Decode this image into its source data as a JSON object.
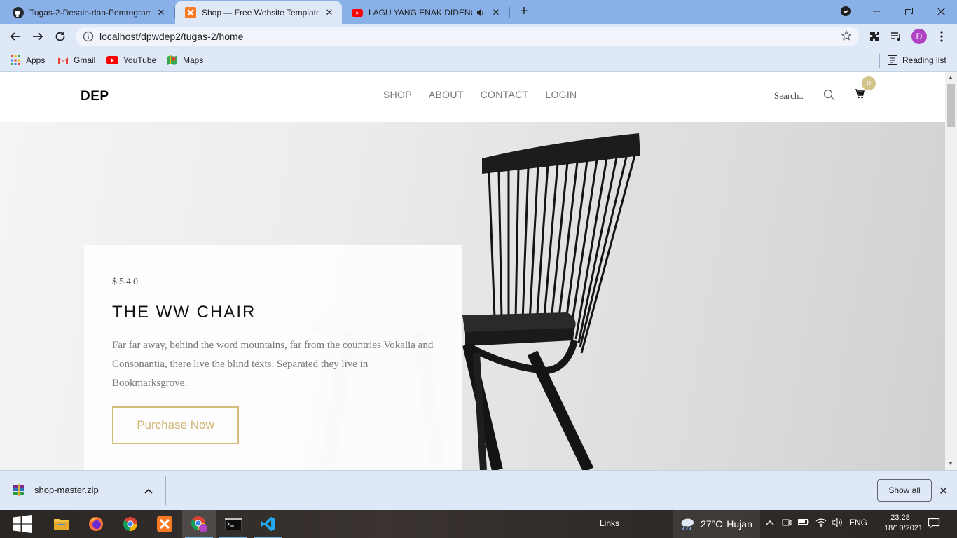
{
  "browser": {
    "tabs": [
      {
        "title": "Tugas-2-Desain-dan-Pemrogram",
        "icon": "github-icon",
        "active": false
      },
      {
        "title": "Shop — Free Website Template, F",
        "icon": "xampp-icon",
        "active": true
      },
      {
        "title": "LAGU YANG ENAK DIDENGA",
        "icon": "youtube-icon",
        "active": false,
        "audio": true
      }
    ],
    "url": "localhost/dpwdep2/tugas-2/home",
    "profile_initial": "D",
    "bookmarks": [
      {
        "label": "Apps",
        "icon": "apps-grid-icon"
      },
      {
        "label": "Gmail",
        "icon": "gmail-icon"
      },
      {
        "label": "YouTube",
        "icon": "youtube-icon"
      },
      {
        "label": "Maps",
        "icon": "maps-icon"
      }
    ],
    "reading_list": "Reading list"
  },
  "site": {
    "logo": "DEP",
    "menu": [
      "SHOP",
      "ABOUT",
      "CONTACT",
      "LOGIN"
    ],
    "search_placeholder": "Search..",
    "cart_count": "0",
    "accent": "#d4bd7c"
  },
  "hero": {
    "price": "$540",
    "title": "THE WW CHAIR",
    "description": "Far far away, behind the word mountains, far from the countries Vokalia and Consonantia, there live the blind texts. Separated they live in Bookmarksgrove.",
    "button": "Purchase Now"
  },
  "downloads": {
    "file": "shop-master.zip",
    "show_all": "Show all"
  },
  "taskbar": {
    "links": "Links",
    "temperature": "27°C",
    "weather": "Hujan",
    "language": "ENG",
    "time": "23:28",
    "date": "18/10/2021"
  }
}
